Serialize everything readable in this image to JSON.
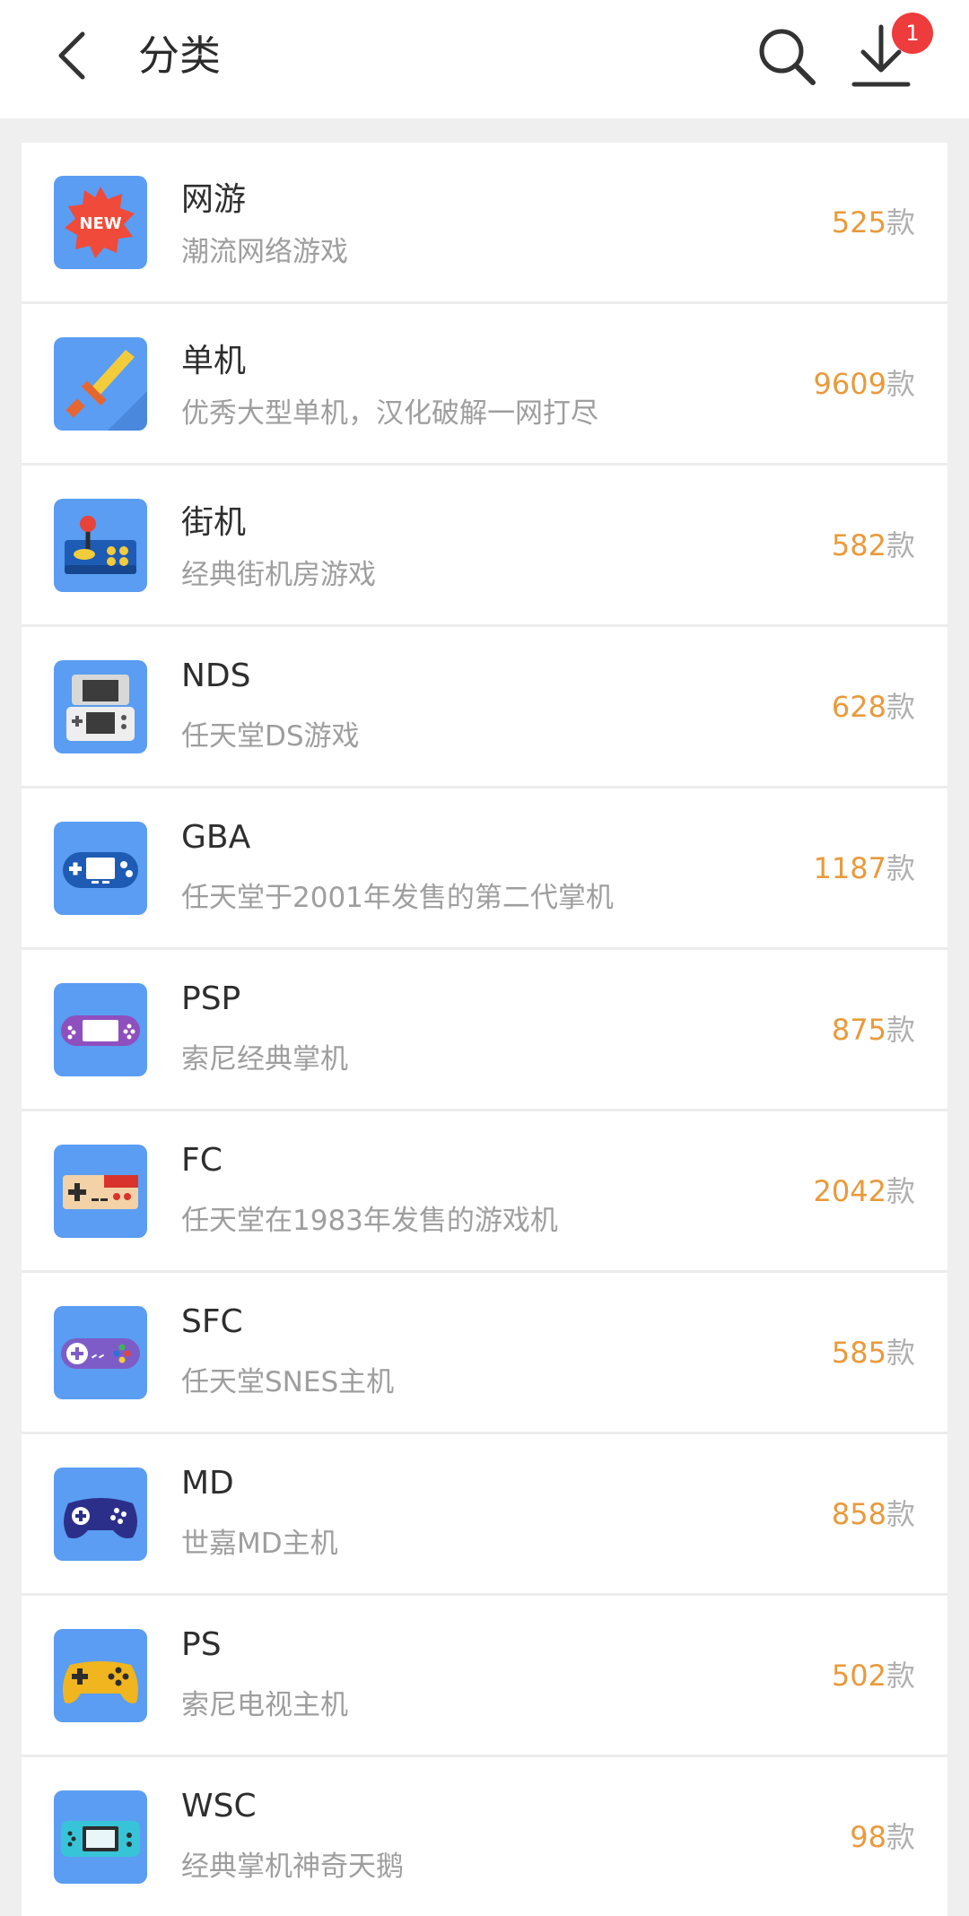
{
  "header": {
    "title": "分类",
    "back_icon": "chevron-left-icon",
    "search_icon": "search-icon",
    "download_icon": "download-icon",
    "download_badge": "1"
  },
  "colors": {
    "count_text": "#e99a3c",
    "badge": "#ee3b3b",
    "icon_bg": "#5a9df2"
  },
  "categories": [
    {
      "name": "网游",
      "desc": "潮流网络游戏",
      "count": "525",
      "unit": "款",
      "icon": "new-badge-icon"
    },
    {
      "name": "单机",
      "desc": "优秀大型单机，汉化破解一网打尽",
      "count": "9609",
      "unit": "款",
      "icon": "sword-icon"
    },
    {
      "name": "街机",
      "desc": "经典街机房游戏",
      "count": "582",
      "unit": "款",
      "icon": "arcade-joystick-icon"
    },
    {
      "name": "NDS",
      "desc": "任天堂DS游戏",
      "count": "628",
      "unit": "款",
      "icon": "nds-console-icon"
    },
    {
      "name": "GBA",
      "desc": "任天堂于2001年发售的第二代掌机",
      "count": "1187",
      "unit": "款",
      "icon": "gba-console-icon"
    },
    {
      "name": "PSP",
      "desc": "索尼经典掌机",
      "count": "875",
      "unit": "款",
      "icon": "psp-console-icon"
    },
    {
      "name": "FC",
      "desc": "任天堂在1983年发售的游戏机",
      "count": "2042",
      "unit": "款",
      "icon": "fc-controller-icon"
    },
    {
      "name": "SFC",
      "desc": "任天堂SNES主机",
      "count": "585",
      "unit": "款",
      "icon": "snes-controller-icon"
    },
    {
      "name": "MD",
      "desc": "世嘉MD主机",
      "count": "858",
      "unit": "款",
      "icon": "md-controller-icon"
    },
    {
      "name": "PS",
      "desc": "索尼电视主机",
      "count": "502",
      "unit": "款",
      "icon": "ps-controller-icon"
    },
    {
      "name": "WSC",
      "desc": "经典掌机神奇天鹅",
      "count": "98",
      "unit": "款",
      "icon": "wsc-console-icon"
    }
  ]
}
